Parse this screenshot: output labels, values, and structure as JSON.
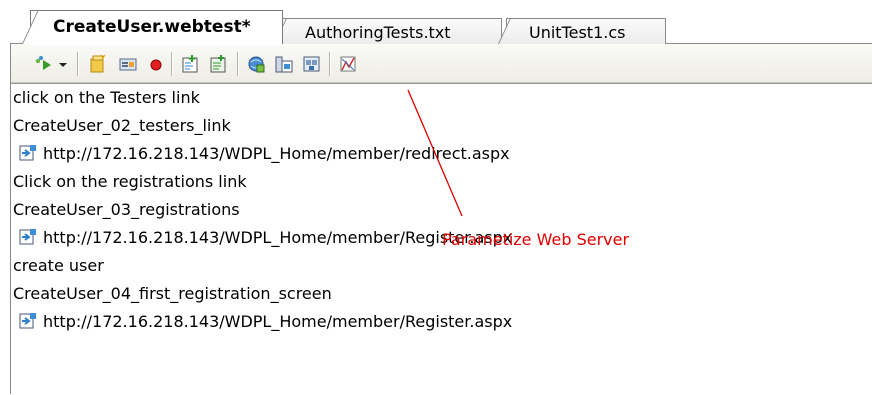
{
  "tabs": [
    {
      "label": "CreateUser.webtest*",
      "active": true
    },
    {
      "label": "AuthoringTests.txt",
      "active": false
    },
    {
      "label": "UnitTest1.cs",
      "active": false
    }
  ],
  "toolbar": {
    "buttons": [
      {
        "icon": "run-test-icon"
      },
      {
        "icon": "dropdown-arrow-icon"
      },
      {
        "icon": "add-folder-icon"
      },
      {
        "icon": "add-data-source-icon"
      },
      {
        "icon": "record-icon"
      },
      {
        "icon": "add-request-icon"
      },
      {
        "icon": "add-transaction-icon"
      },
      {
        "icon": "add-web-test-plugin-icon"
      },
      {
        "icon": "parameterize-web-server-icon"
      },
      {
        "icon": "set-credentials-icon"
      },
      {
        "icon": "generate-code-icon"
      }
    ]
  },
  "items": [
    {
      "type": "comment",
      "text": "click on the Testers link"
    },
    {
      "type": "transaction",
      "text": "CreateUser_02_testers_link"
    },
    {
      "type": "request",
      "text": "http://172.16.218.143/WDPL_Home/member/redirect.aspx"
    },
    {
      "type": "comment",
      "text": "Click on the registrations link"
    },
    {
      "type": "transaction",
      "text": "CreateUser_03_registrations"
    },
    {
      "type": "request",
      "text": "http://172.16.218.143/WDPL_Home/member/Register.aspx"
    },
    {
      "type": "comment",
      "text": "create user"
    },
    {
      "type": "transaction",
      "text": "CreateUser_04_first_registration_screen"
    },
    {
      "type": "request",
      "text": "http://172.16.218.143/WDPL_Home/member/Register.aspx"
    }
  ],
  "annotation": {
    "text": "Parametize Web Server",
    "color": "#e00000"
  }
}
